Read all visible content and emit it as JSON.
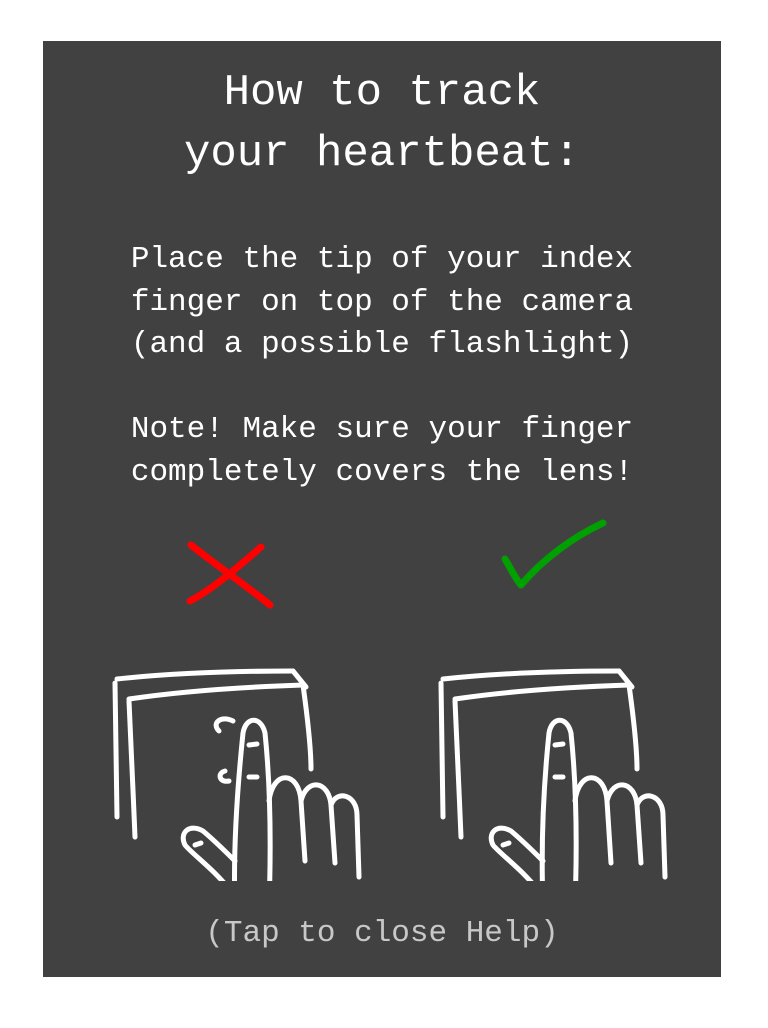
{
  "help": {
    "title_line1": "How to track",
    "title_line2": "your heartbeat:",
    "instruction_line1": "Place the tip of your index",
    "instruction_line2": "finger on top of the camera",
    "instruction_line3": "(and a possible flashlight)",
    "note_line1": "Note! Make sure your finger",
    "note_line2": "completely covers the lens!",
    "close_hint": "(Tap to close Help)"
  },
  "icons": {
    "wrong": "red-x-icon",
    "right": "green-checkmark-icon"
  },
  "colors": {
    "panel_background": "#414141",
    "page_background": "#ffffff",
    "text": "#ffffff",
    "hint_text": "#c8c8c8",
    "wrong_mark": "#ff0000",
    "right_mark": "#00a000"
  }
}
